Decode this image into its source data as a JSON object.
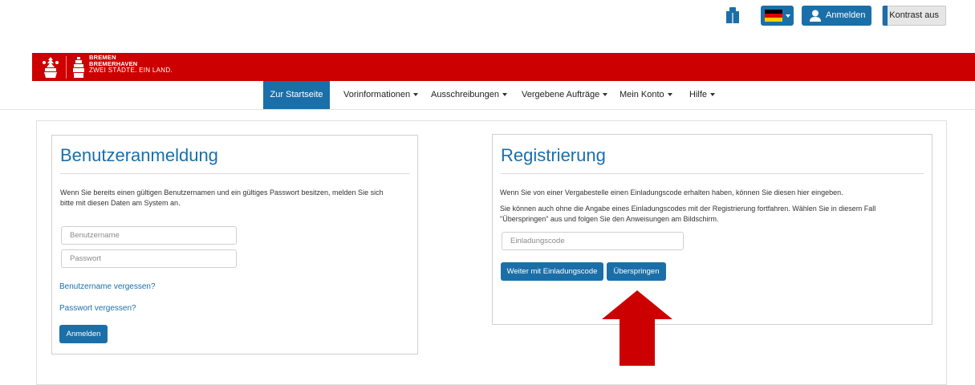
{
  "topbar": {
    "login_label": "Anmelden",
    "contrast_label": "Kontrast aus",
    "icons": [
      "book-icon",
      "flag-germany-icon",
      "user-icon"
    ]
  },
  "brand": {
    "line1": "BREMEN",
    "line2": "BREMERHAVEN",
    "line3": "ZWEI STÄDTE. EIN LAND.",
    "color": "#cc0000"
  },
  "nav": {
    "home": "Zur Startseite",
    "items": [
      "Vorinformationen",
      "Ausschreibungen",
      "Vergebene Aufträge",
      "Mein Konto",
      "Hilfe"
    ]
  },
  "login": {
    "title": "Benutzeranmeldung",
    "text_line1": "Wenn Sie bereits einen gültigen Benutzernamen und ein gültiges Passwort besitzen, melden Sie sich",
    "text_line2": "bitte mit diesen Daten am System an.",
    "username_placeholder": "Benutzername",
    "password_placeholder": "Passwort",
    "forgot_username": "Benutzername vergessen?",
    "forgot_password": "Passwort vergessen?",
    "submit": "Anmelden"
  },
  "registration": {
    "title": "Registrierung",
    "text1": "Wenn Sie von einer Vergabestelle einen Einladungscode erhalten haben, können Sie diesen hier eingeben.",
    "text2_line1": "Sie können auch ohne die Angabe eines Einladungscodes mit der Registrierung fortfahren. Wählen Sie in diesem Fall",
    "text2_line2": "\"Überspringen\" aus und folgen Sie den Anweisungen am Bildschirm.",
    "code_placeholder": "Einladungscode",
    "continue_button": "Weiter mit Einladungscode",
    "skip_button": "Überspringen"
  },
  "colors": {
    "accent": "#1b6fa8",
    "arrow": "#cc0000"
  }
}
